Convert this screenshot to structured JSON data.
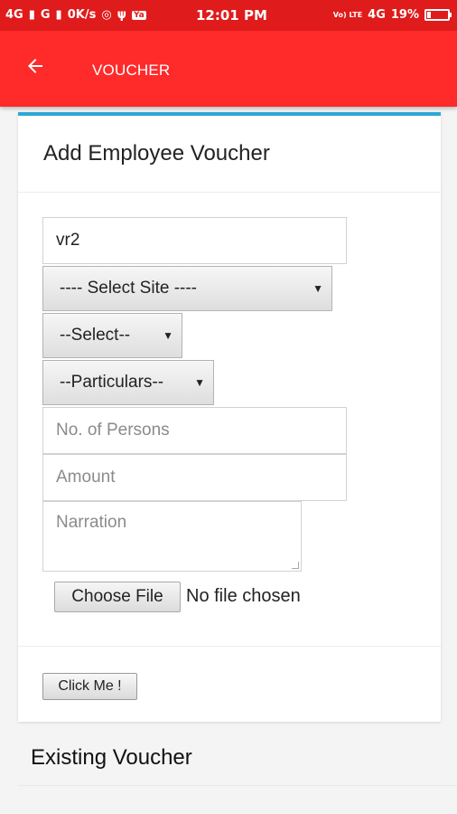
{
  "status_bar": {
    "network_left": "4G",
    "network_left2": "G",
    "data_speed": "0K/s",
    "usb_glyph": "ψ",
    "app_badge": "Ya",
    "time": "12:01 PM",
    "volte": "Vo) LTE",
    "network_right": "4G",
    "battery": "19%"
  },
  "appbar": {
    "title": "VOUCHER",
    "back_icon": "arrow-left-icon"
  },
  "form": {
    "title": "Add Employee Voucher",
    "voucher_value": "vr2",
    "site_select": "---- Select Site ----",
    "type_select": "--Select--",
    "particulars_select": "--Particulars--",
    "persons_placeholder": "No. of Persons",
    "amount_placeholder": "Amount",
    "narration_placeholder": "Narration",
    "choose_file": "Choose File",
    "no_file": "No file chosen",
    "submit": "Click Me !"
  },
  "existing": {
    "title": "Existing Voucher"
  },
  "colors": {
    "status_bar": "#e01b1b",
    "appbar": "#ff2a2a",
    "card_accent": "#2ea7d6"
  }
}
